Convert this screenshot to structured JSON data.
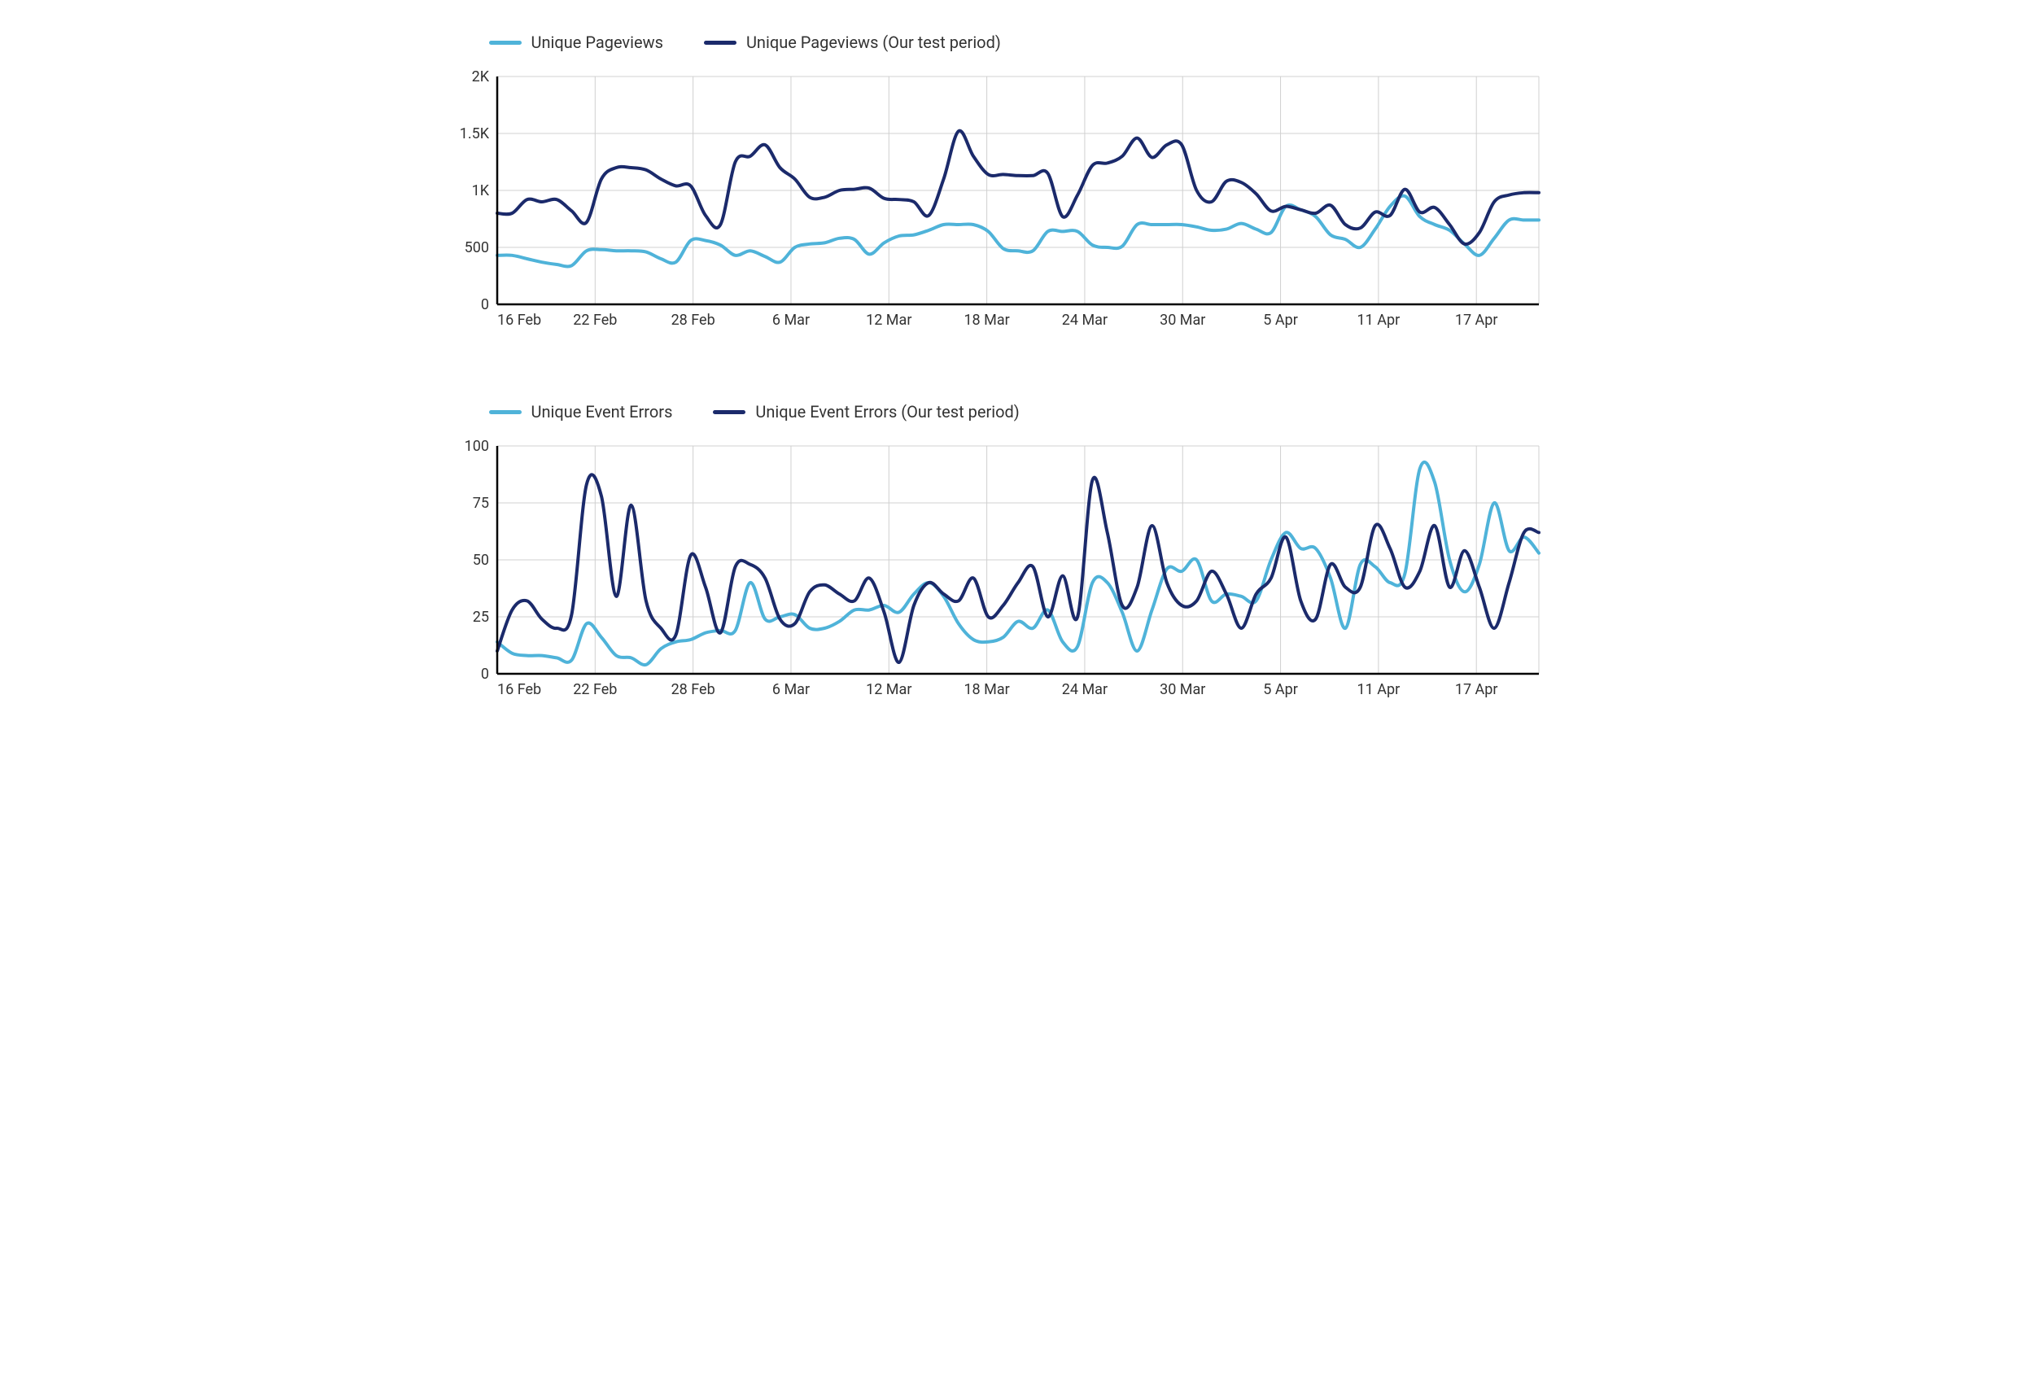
{
  "colors": {
    "light": "#4FB3D9",
    "dark": "#1B2A6B"
  },
  "x_categories": [
    "16 Feb",
    "22 Feb",
    "28 Feb",
    "6 Mar",
    "12 Mar",
    "18 Mar",
    "24 Mar",
    "30 Mar",
    "5 Apr",
    "11 Apr",
    "17 Apr"
  ],
  "chart_data": [
    {
      "type": "line",
      "title": "",
      "xlabel": "",
      "ylabel": "",
      "x_tick_labels": [
        "16 Feb",
        "22 Feb",
        "28 Feb",
        "6 Mar",
        "12 Mar",
        "18 Mar",
        "24 Mar",
        "30 Mar",
        "5 Apr",
        "11 Apr",
        "17 Apr"
      ],
      "y_tick_labels": [
        "0",
        "500",
        "1K",
        "1.5K",
        "2K"
      ],
      "ylim": [
        0,
        2000
      ],
      "legend": [
        "Unique Pageviews",
        "Unique Pageviews (Our test period)"
      ],
      "series": [
        {
          "name": "Unique Pageviews",
          "color_key": "light",
          "values": [
            430,
            430,
            400,
            370,
            350,
            340,
            470,
            480,
            470,
            470,
            460,
            400,
            370,
            560,
            560,
            520,
            430,
            470,
            420,
            370,
            500,
            530,
            540,
            580,
            570,
            440,
            540,
            600,
            610,
            650,
            700,
            700,
            700,
            640,
            490,
            470,
            470,
            640,
            640,
            640,
            520,
            500,
            510,
            700,
            700,
            700,
            700,
            680,
            650,
            660,
            710,
            660,
            630,
            860,
            830,
            770,
            610,
            570,
            500,
            660,
            860,
            950,
            770,
            700,
            650,
            530,
            430,
            580,
            740,
            740,
            740
          ]
        },
        {
          "name": "Unique Pageviews (Our test period)",
          "color_key": "dark",
          "values": [
            800,
            800,
            920,
            900,
            920,
            820,
            720,
            1100,
            1200,
            1200,
            1180,
            1100,
            1040,
            1040,
            780,
            700,
            1250,
            1300,
            1400,
            1200,
            1100,
            940,
            940,
            1000,
            1010,
            1020,
            930,
            920,
            900,
            780,
            1100,
            1520,
            1300,
            1140,
            1140,
            1130,
            1130,
            1150,
            770,
            960,
            1220,
            1240,
            1300,
            1460,
            1290,
            1400,
            1400,
            1000,
            900,
            1080,
            1070,
            970,
            820,
            860,
            830,
            800,
            870,
            700,
            670,
            810,
            780,
            1010,
            810,
            850,
            700,
            530,
            630,
            900,
            960,
            980,
            980
          ]
        }
      ]
    },
    {
      "type": "line",
      "title": "",
      "xlabel": "",
      "ylabel": "",
      "x_tick_labels": [
        "16 Feb",
        "22 Feb",
        "28 Feb",
        "6 Mar",
        "12 Mar",
        "18 Mar",
        "24 Mar",
        "30 Mar",
        "5 Apr",
        "11 Apr",
        "17 Apr"
      ],
      "y_tick_labels": [
        "0",
        "25",
        "50",
        "75",
        "100"
      ],
      "ylim": [
        0,
        100
      ],
      "legend": [
        "Unique Event Errors",
        "Unique Event Errors (Our test period)"
      ],
      "series": [
        {
          "name": "Unique Event Errors",
          "color_key": "light",
          "values": [
            14,
            9,
            8,
            8,
            7,
            6,
            22,
            16,
            8,
            7,
            4,
            11,
            14,
            15,
            18,
            19,
            19,
            40,
            24,
            25,
            26,
            20,
            20,
            23,
            28,
            28,
            30,
            27,
            35,
            40,
            34,
            22,
            15,
            14,
            16,
            23,
            20,
            28,
            14,
            12,
            40,
            40,
            27,
            10,
            28,
            46,
            45,
            50,
            32,
            35,
            34,
            32,
            50,
            62,
            55,
            55,
            42,
            20,
            48,
            47,
            40,
            44,
            90,
            84,
            50,
            36,
            48,
            75,
            54,
            60,
            53
          ]
        },
        {
          "name": "Unique Event Errors (Our test period)",
          "color_key": "dark",
          "values": [
            10,
            28,
            32,
            24,
            20,
            26,
            83,
            78,
            34,
            74,
            32,
            20,
            17,
            52,
            38,
            18,
            47,
            48,
            42,
            24,
            22,
            36,
            39,
            35,
            32,
            42,
            27,
            5,
            30,
            40,
            35,
            32,
            42,
            25,
            30,
            40,
            47,
            25,
            43,
            25,
            85,
            62,
            30,
            38,
            65,
            40,
            30,
            32,
            45,
            35,
            20,
            35,
            42,
            60,
            32,
            24,
            48,
            38,
            38,
            65,
            55,
            38,
            45,
            65,
            38,
            54,
            38,
            20,
            40,
            62,
            62
          ]
        }
      ]
    }
  ]
}
